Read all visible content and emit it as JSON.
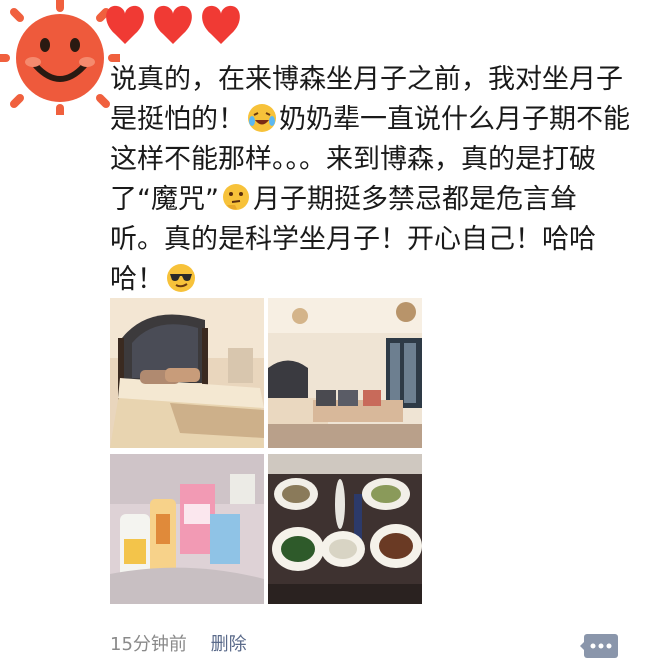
{
  "post": {
    "text_1": "说真的，在来博森坐月子之前，我对坐月子是挺怕的！",
    "text_2": "奶奶辈一直说什么月子期不能这样不能那样。。。来到博森，真的是打破了“魔咒”",
    "text_3": "月子期挺多禁忌都是危言耸听。真的是科学坐月子！开心自己！哈哈哈！",
    "emojis": [
      "crying-laughing-emoji",
      "thinking-emoji",
      "sunglasses-emoji"
    ],
    "photos": [
      "bedroom-photo",
      "living-room-photo",
      "baby-products-photo",
      "meal-photo"
    ]
  },
  "footer": {
    "time": "15分钟前",
    "delete_label": "删除"
  },
  "colors": {
    "avatar_face": "#ee5a3c",
    "hearts": "#f03a34",
    "link_blue": "#5a6a8a",
    "muted_gray": "#8a8a8a",
    "comment_button": "#8a96ab"
  }
}
